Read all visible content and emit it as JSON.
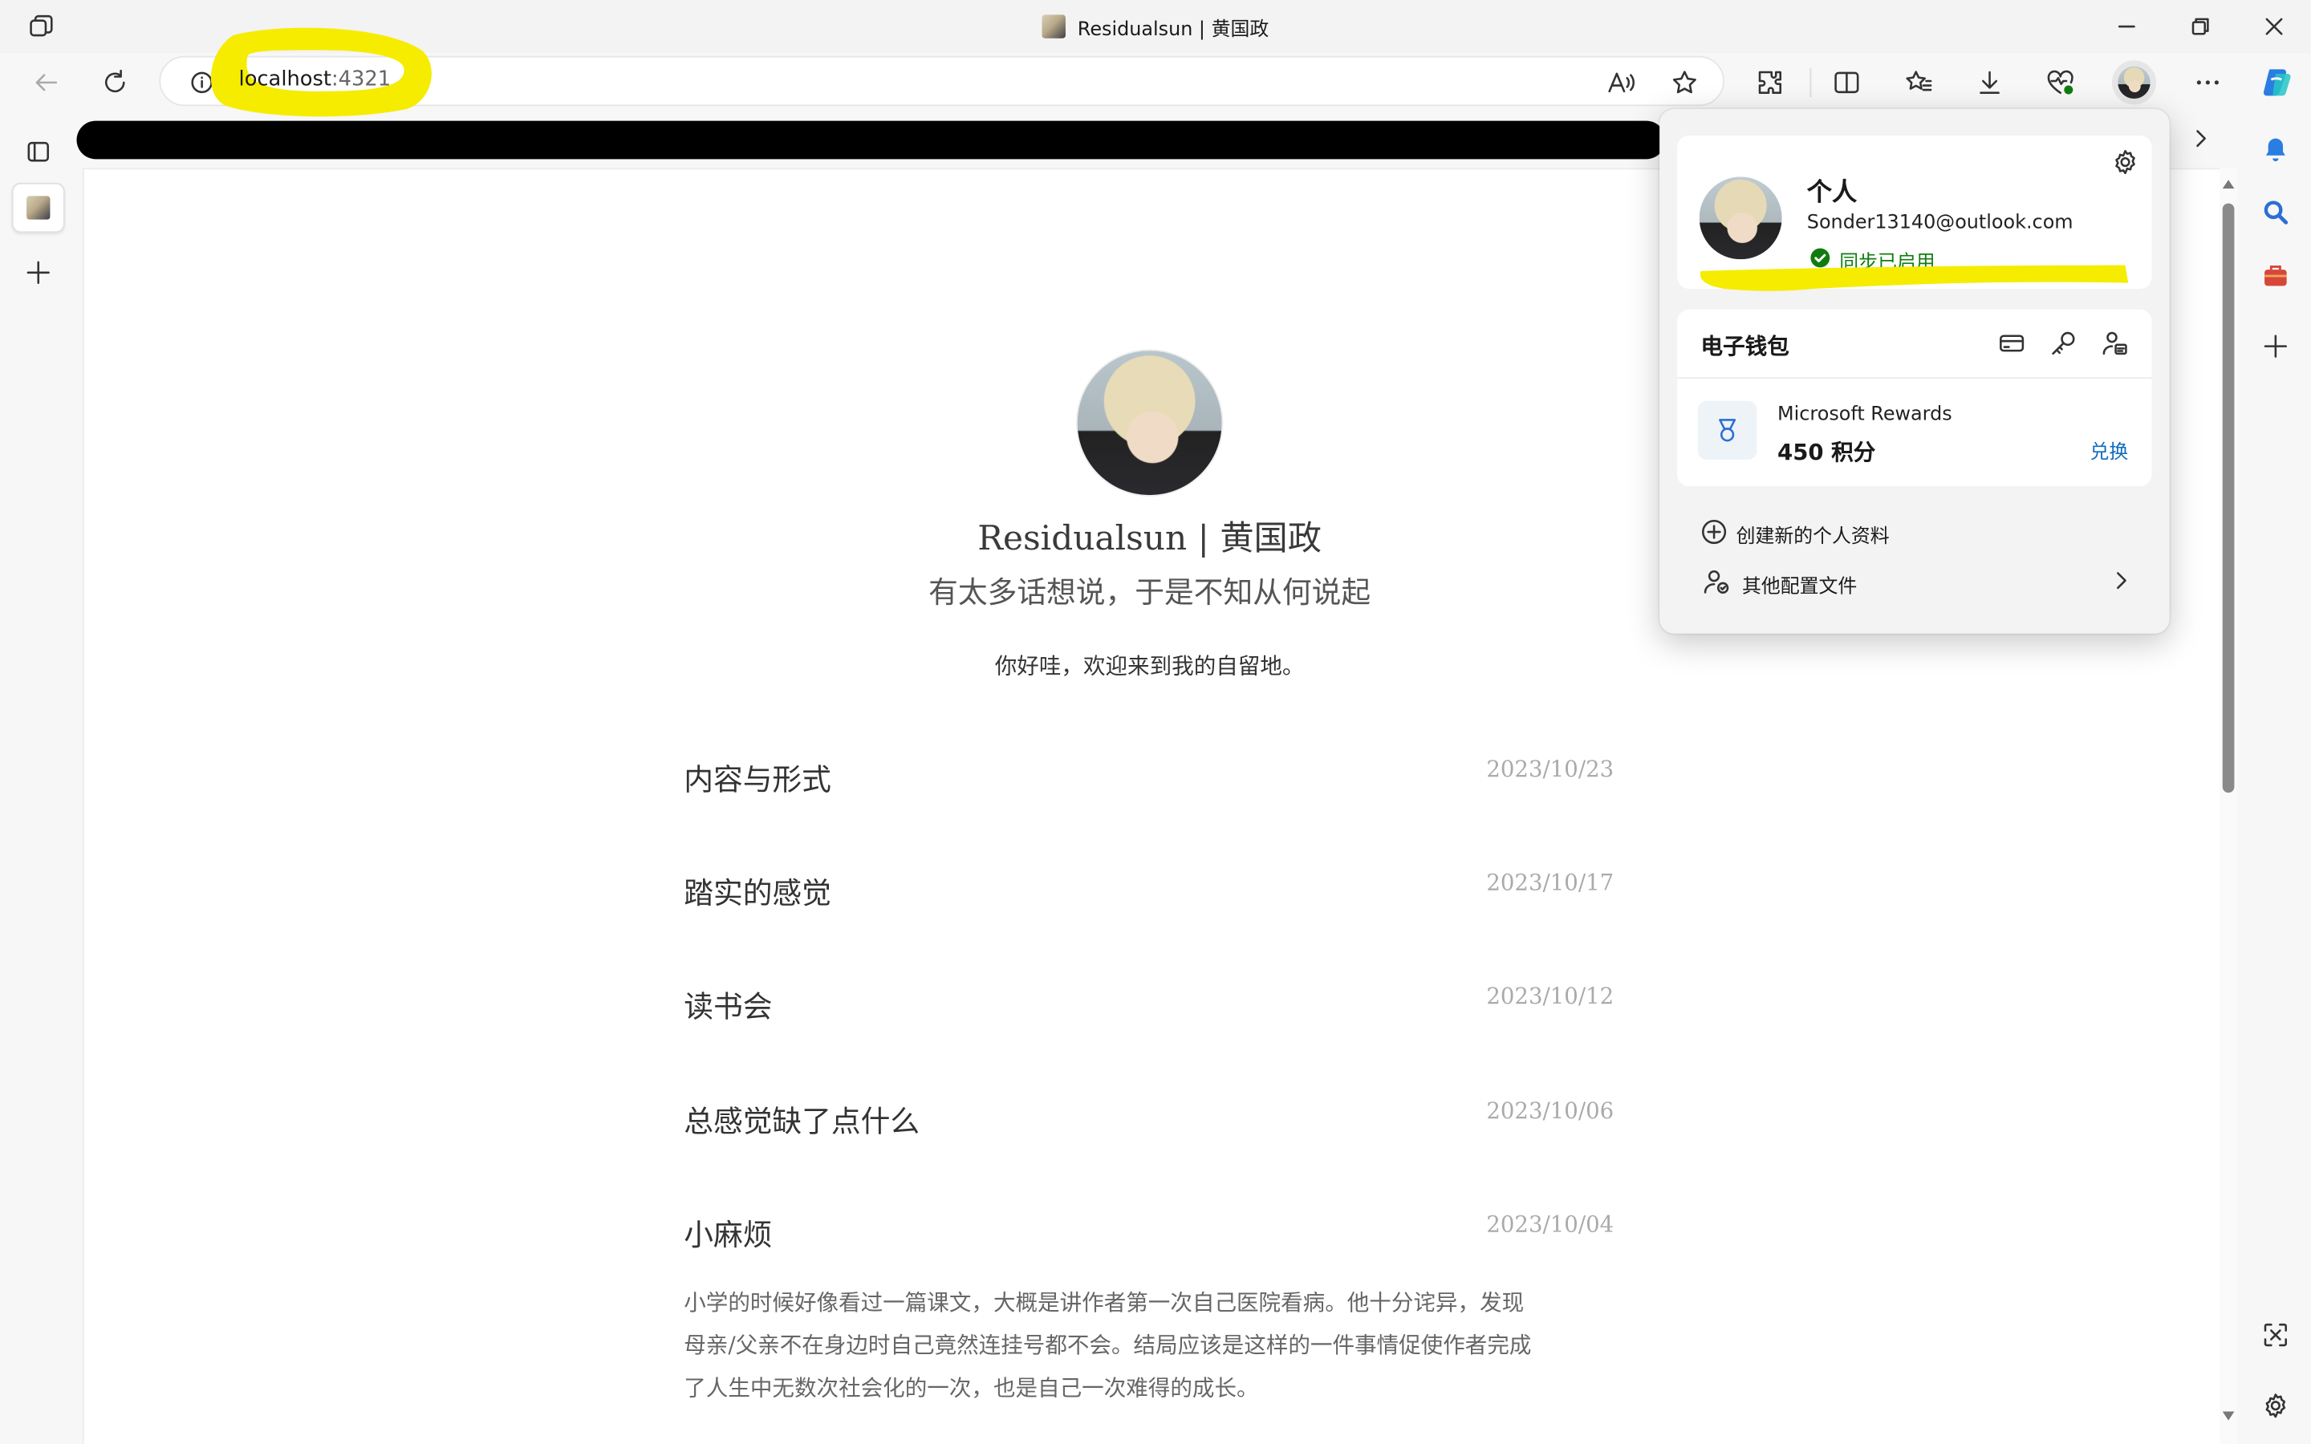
{
  "window": {
    "tab_title": "Residualsun | 黄国政",
    "controls": [
      "minimize-icon",
      "restore-icon",
      "close-icon"
    ]
  },
  "toolbar": {
    "url_host": "localhost",
    "url_port": ":4321",
    "icons": [
      "back-icon",
      "refresh-icon",
      "site-info-icon",
      "read-aloud-icon",
      "favorite-star-icon",
      "extensions-icon",
      "split-screen-icon",
      "favorites-icon",
      "downloads-icon",
      "browser-essentials-icon",
      "profile-avatar",
      "more-icon",
      "copilot-icon"
    ]
  },
  "page": {
    "site_title": "Residualsun | 黄国政",
    "site_subtitle": "有太多话想说，于是不知从何说起",
    "greeting": "你好哇，欢迎来到我的自留地。",
    "posts": [
      {
        "title": "内容与形式",
        "date": "2023/10/23"
      },
      {
        "title": "踏实的感觉",
        "date": "2023/10/17"
      },
      {
        "title": "读书会",
        "date": "2023/10/12"
      },
      {
        "title": "总感觉缺了点什么",
        "date": "2023/10/06"
      },
      {
        "title": "小麻烦",
        "date": "2023/10/04"
      }
    ],
    "excerpt_lines": [
      "小学的时候好像看过一篇课文，大概是讲作者第一次自己医院看病。他十分诧异，发现",
      "母亲/父亲不在身边时自己竟然连挂号都不会。结局应该是这样的一件事情促使作者完成",
      "了人生中无数次社会化的一次，也是自己一次难得的成长。"
    ]
  },
  "profile_flyout": {
    "name": "个人",
    "email": "Sonder13140@outlook.com",
    "sync_status": "同步已启用",
    "wallet_title": "电子钱包",
    "rewards_name": "Microsoft Rewards",
    "rewards_points": "450 积分",
    "redeem_label": "兑换",
    "create_profile_label": "创建新的个人资料",
    "other_profiles_label": "其他配置文件"
  },
  "colors": {
    "highlight": "#f5ec00",
    "sync_green": "#107c10",
    "link_blue": "#0f6cbd"
  }
}
